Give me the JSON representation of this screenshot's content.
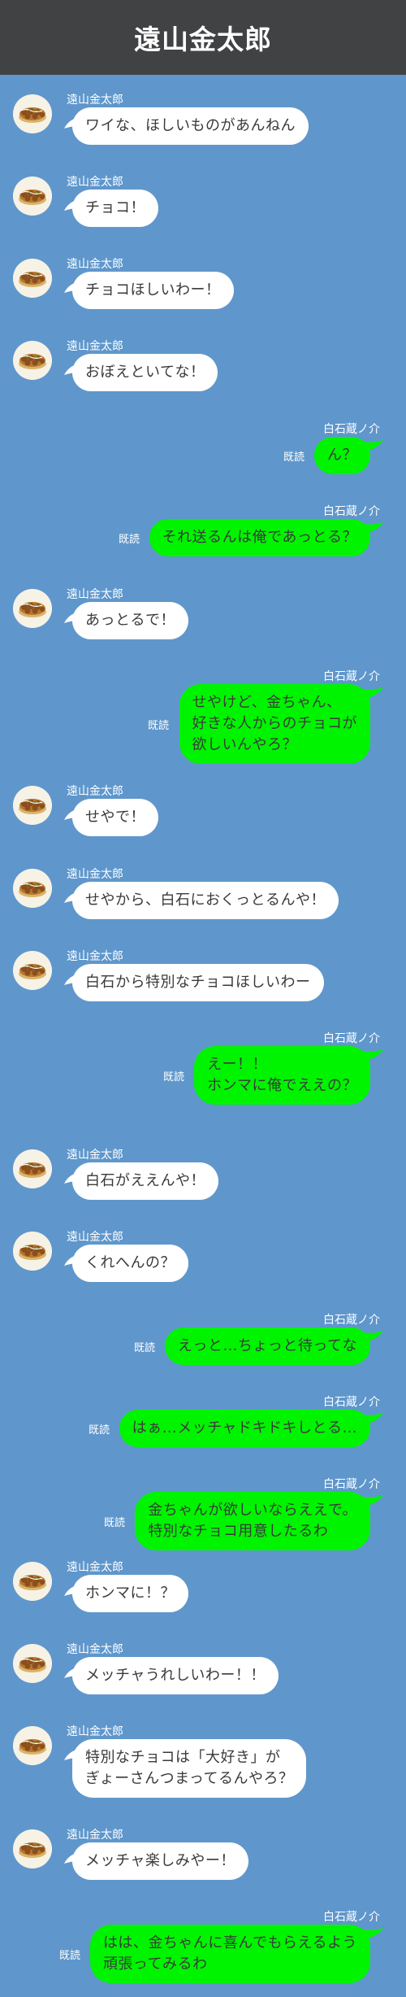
{
  "header": {
    "title": "遠山金太郎"
  },
  "colors": {
    "background": "#5f97cc",
    "header": "#414244",
    "incoming": "#ffffff",
    "outgoing": "#00f400"
  },
  "participants": {
    "left": "遠山金太郎",
    "right": "白石蔵ノ介"
  },
  "messages": [
    {
      "side": "left",
      "name": "遠山金太郎",
      "text": "ワイな、ほしいものがあんねん"
    },
    {
      "side": "left",
      "name": "遠山金太郎",
      "text": "チョコ！"
    },
    {
      "side": "left",
      "name": "遠山金太郎",
      "text": "チョコほしいわー！"
    },
    {
      "side": "left",
      "name": "遠山金太郎",
      "text": "おぼえといてな！"
    },
    {
      "side": "right",
      "name": "白石蔵ノ介",
      "read": "既読",
      "text": "ん？"
    },
    {
      "side": "right",
      "name": "白石蔵ノ介",
      "read": "既読",
      "text": "それ送るんは俺であっとる？"
    },
    {
      "side": "left",
      "name": "遠山金太郎",
      "text": "あっとるで！"
    },
    {
      "side": "right",
      "name": "白石蔵ノ介",
      "read": "既読",
      "text": "せやけど、金ちゃん、\n好きな人からのチョコが\n欲しいんやろ？"
    },
    {
      "side": "left",
      "name": "遠山金太郎",
      "text": "せやで！"
    },
    {
      "side": "left",
      "name": "遠山金太郎",
      "text": "せやから、白石におくっとるんや！"
    },
    {
      "side": "left",
      "name": "遠山金太郎",
      "text": "白石から特別なチョコほしいわー"
    },
    {
      "side": "right",
      "name": "白石蔵ノ介",
      "read": "既読",
      "text": "えー！！\nホンマに俺でええの？"
    },
    {
      "side": "left",
      "name": "遠山金太郎",
      "text": "白石がええんや！"
    },
    {
      "side": "left",
      "name": "遠山金太郎",
      "text": "くれへんの？"
    },
    {
      "side": "right",
      "name": "白石蔵ノ介",
      "read": "既読",
      "text": "えっと…ちょっと待ってな"
    },
    {
      "side": "right",
      "name": "白石蔵ノ介",
      "read": "既読",
      "text": "はぁ…メッチャドキドキしとる…"
    },
    {
      "side": "right",
      "name": "白石蔵ノ介",
      "read": "既読",
      "text": "金ちゃんが欲しいならええで。\n特別なチョコ用意したるわ"
    },
    {
      "side": "left",
      "name": "遠山金太郎",
      "text": "ホンマに！？"
    },
    {
      "side": "left",
      "name": "遠山金太郎",
      "text": "メッチャうれしいわー！！"
    },
    {
      "side": "left",
      "name": "遠山金太郎",
      "text": "特別なチョコは「大好き」が\nぎょーさんつまってるんやろ？"
    },
    {
      "side": "left",
      "name": "遠山金太郎",
      "text": "メッチャ楽しみやー！"
    },
    {
      "side": "right",
      "name": "白石蔵ノ介",
      "read": "既読",
      "text": "はは、金ちゃんに喜んでもらえるよう\n頑張ってみるわ"
    }
  ]
}
